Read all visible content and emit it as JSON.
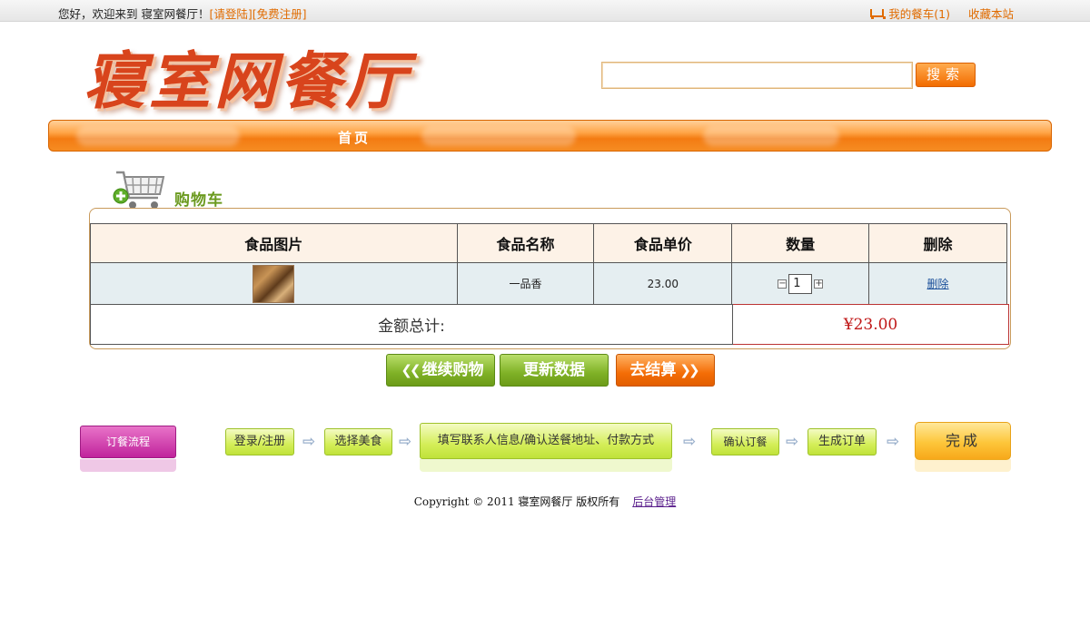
{
  "topbar": {
    "greeting": "您好，欢迎来到 寝室网餐厅！",
    "login": "[请登陆]",
    "register": "[免费注册]",
    "my_cart": "我的餐车(1)",
    "bookmark": "收藏本站"
  },
  "logo": {
    "text": "寝室网餐厅"
  },
  "search": {
    "value": "",
    "button": "搜索"
  },
  "nav": {
    "home": "首页"
  },
  "cart": {
    "title": "购物车",
    "headers": [
      "食品图片",
      "食品名称",
      "食品单价",
      "数量",
      "删除"
    ],
    "rows": [
      {
        "name": "一品香",
        "price": "23.00",
        "qty": "1",
        "delete": "删除"
      }
    ],
    "total_label": "金额总计:",
    "total_value": "¥23.00"
  },
  "actions": {
    "continue": "继续购物",
    "update": "更新数据",
    "checkout": "去结算"
  },
  "flow": {
    "label": "订餐流程",
    "steps": [
      "登录/注册",
      "选择美食",
      "填写联系人信息/确认送餐地址、付款方式",
      "确认订餐",
      "生成订单"
    ],
    "done": "完成"
  },
  "footer": {
    "copyright": "Copyright © 2011 寝室网餐厅 版权所有",
    "admin": "后台管理"
  }
}
